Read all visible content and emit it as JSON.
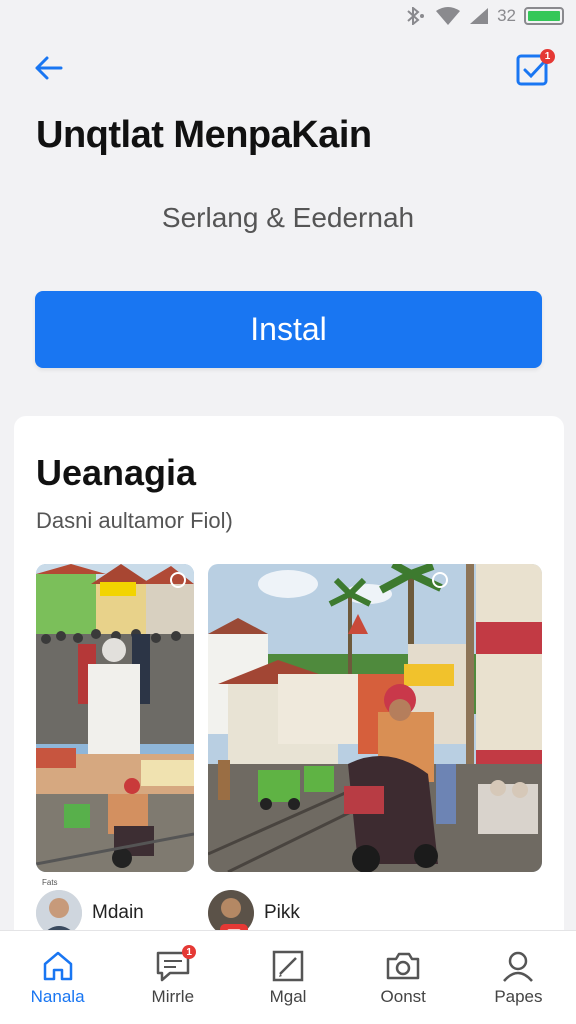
{
  "status_bar": {
    "time": "32",
    "battery_color": "#35c759"
  },
  "header": {
    "task_badge": "1"
  },
  "title": "Unqtlat MenpaKain",
  "subtitle": "Serlang & Eedernah",
  "install_label": "Instal",
  "accent_color": "#1976f2",
  "card": {
    "title": "Ueanagia",
    "subtitle": "Dasni aultamor Fiol)",
    "tiny_label": "Fats",
    "authors": [
      {
        "name": "Mdain"
      },
      {
        "name": "Pikk"
      }
    ]
  },
  "bottom_nav": {
    "items": [
      {
        "label": "Nanala",
        "icon": "home-icon",
        "active": true
      },
      {
        "label": "Mirrle",
        "icon": "message-icon",
        "badge": "1"
      },
      {
        "label": "Mgal",
        "icon": "edit-icon"
      },
      {
        "label": "Oonst",
        "icon": "camera-icon"
      },
      {
        "label": "Papes",
        "icon": "profile-icon"
      }
    ]
  }
}
